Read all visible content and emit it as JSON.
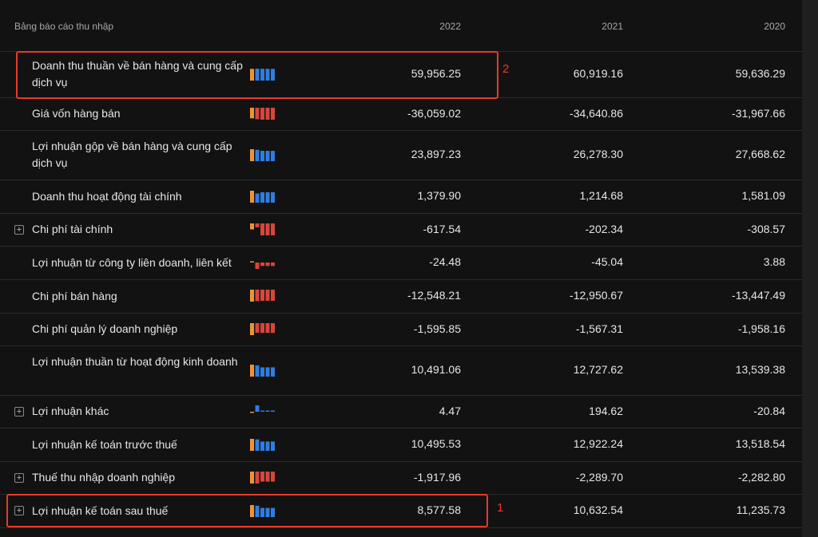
{
  "table": {
    "title": "Bảng báo cáo thu nhập",
    "years": [
      "2022",
      "2021",
      "2020"
    ],
    "rows": [
      {
        "label": "Doanh thu thuần về bán hàng và cung cấp dịch vụ",
        "values": [
          "59,956.25",
          "60,919.16",
          "59,636.29"
        ],
        "expandable": false
      },
      {
        "label": "Giá vốn hàng bán",
        "values": [
          "-36,059.02",
          "-34,640.86",
          "-31,967.66"
        ],
        "expandable": false
      },
      {
        "label": "Lợi nhuận gộp về bán hàng và cung cấp dịch vụ",
        "values": [
          "23,897.23",
          "26,278.30",
          "27,668.62"
        ],
        "expandable": false
      },
      {
        "label": "Doanh thu hoạt động tài chính",
        "values": [
          "1,379.90",
          "1,214.68",
          "1,581.09"
        ],
        "expandable": false
      },
      {
        "label": "Chi phí tài chính",
        "values": [
          "-617.54",
          "-202.34",
          "-308.57"
        ],
        "expandable": true
      },
      {
        "label": "Lợi nhuận từ công ty liên doanh, liên kết",
        "values": [
          "-24.48",
          "-45.04",
          "3.88"
        ],
        "expandable": false
      },
      {
        "label": "Chi phí bán hàng",
        "values": [
          "-12,548.21",
          "-12,950.67",
          "-13,447.49"
        ],
        "expandable": false
      },
      {
        "label": "Chi phí quản lý doanh nghiệp",
        "values": [
          "-1,595.85",
          "-1,567.31",
          "-1,958.16"
        ],
        "expandable": false
      },
      {
        "label": "Lợi nhuận thuần từ hoạt động kinh doanh",
        "values": [
          "10,491.06",
          "12,727.62",
          "13,539.38"
        ],
        "expandable": false
      },
      {
        "label": "Lợi nhuận khác",
        "values": [
          "4.47",
          "194.62",
          "-20.84"
        ],
        "expandable": true
      },
      {
        "label": "Lợi nhuận kế toán trước thuế",
        "values": [
          "10,495.53",
          "12,922.24",
          "13,518.54"
        ],
        "expandable": false
      },
      {
        "label": "Thuế thu nhập doanh nghiệp",
        "values": [
          "-1,917.96",
          "-2,289.70",
          "-2,282.80"
        ],
        "expandable": true
      },
      {
        "label": "Lợi nhuận kế toán sau thuế",
        "values": [
          "8,577.58",
          "10,632.54",
          "11,235.73"
        ],
        "expandable": true
      }
    ]
  },
  "annotations": [
    "1",
    "2"
  ],
  "colors": {
    "positive_bar": "#2f7de1",
    "negative_bar": "#d9453b",
    "latest_bar": "#f0923a",
    "highlight": "#e8392b"
  }
}
